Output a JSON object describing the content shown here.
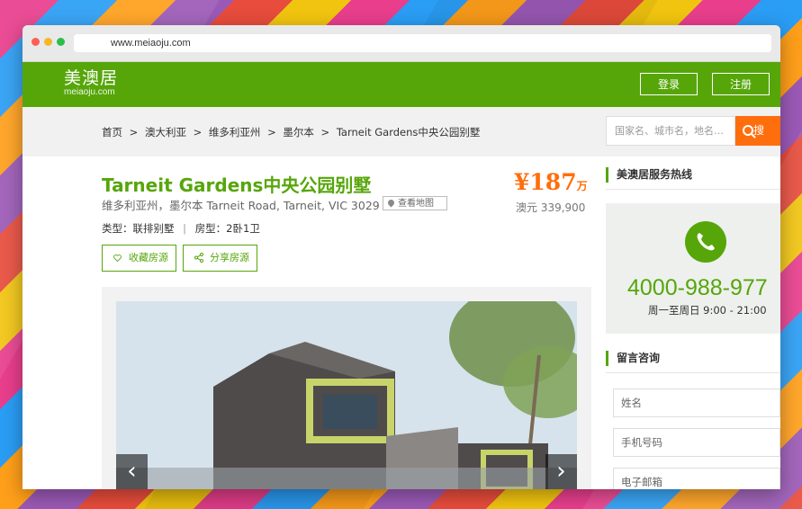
{
  "browser": {
    "url": "www.meiaoju.com"
  },
  "header": {
    "logo_cn": "美澳居",
    "logo_en": "meiaoju.com",
    "login_label": "登录",
    "register_label": "注册",
    "brand_color": "#56a60a"
  },
  "breadcrumb": {
    "items": [
      "首页",
      ">",
      "澳大利亚",
      ">",
      "维多利亚州",
      ">",
      "墨尔本",
      ">",
      "Tarneit Gardens中央公园别墅"
    ]
  },
  "search": {
    "placeholder": "国家名、城市名，地名…",
    "button_label": "搜"
  },
  "listing": {
    "title": "Tarneit Gardens中央公园别墅",
    "address": "维多利亚州，墨尔本 Tarneit Road, Tarneit, VIC 3029",
    "map_label": "查看地图",
    "price_symbol": "¥",
    "price_value": "187",
    "price_unit": "万",
    "price_aud": "澳元 339,900",
    "type_label": "类型：联排别墅",
    "layout_label": "房型：2卧1卫",
    "separator": "|",
    "favorite_label": "收藏房源",
    "share_label": "分享房源",
    "price_color": "#ff6e0d"
  },
  "gallery": {
    "arrow_left": "‹",
    "arrow_right": "›"
  },
  "sidebar": {
    "hotline_title": "美澳居服务热线",
    "phone": "4000-988-977",
    "hours": "周一至周日 9:00 - 21:00",
    "consult_title": "留言咨询",
    "name_placeholder": "姓名",
    "phone_placeholder": "手机号码",
    "email_placeholder": "电子邮箱"
  }
}
